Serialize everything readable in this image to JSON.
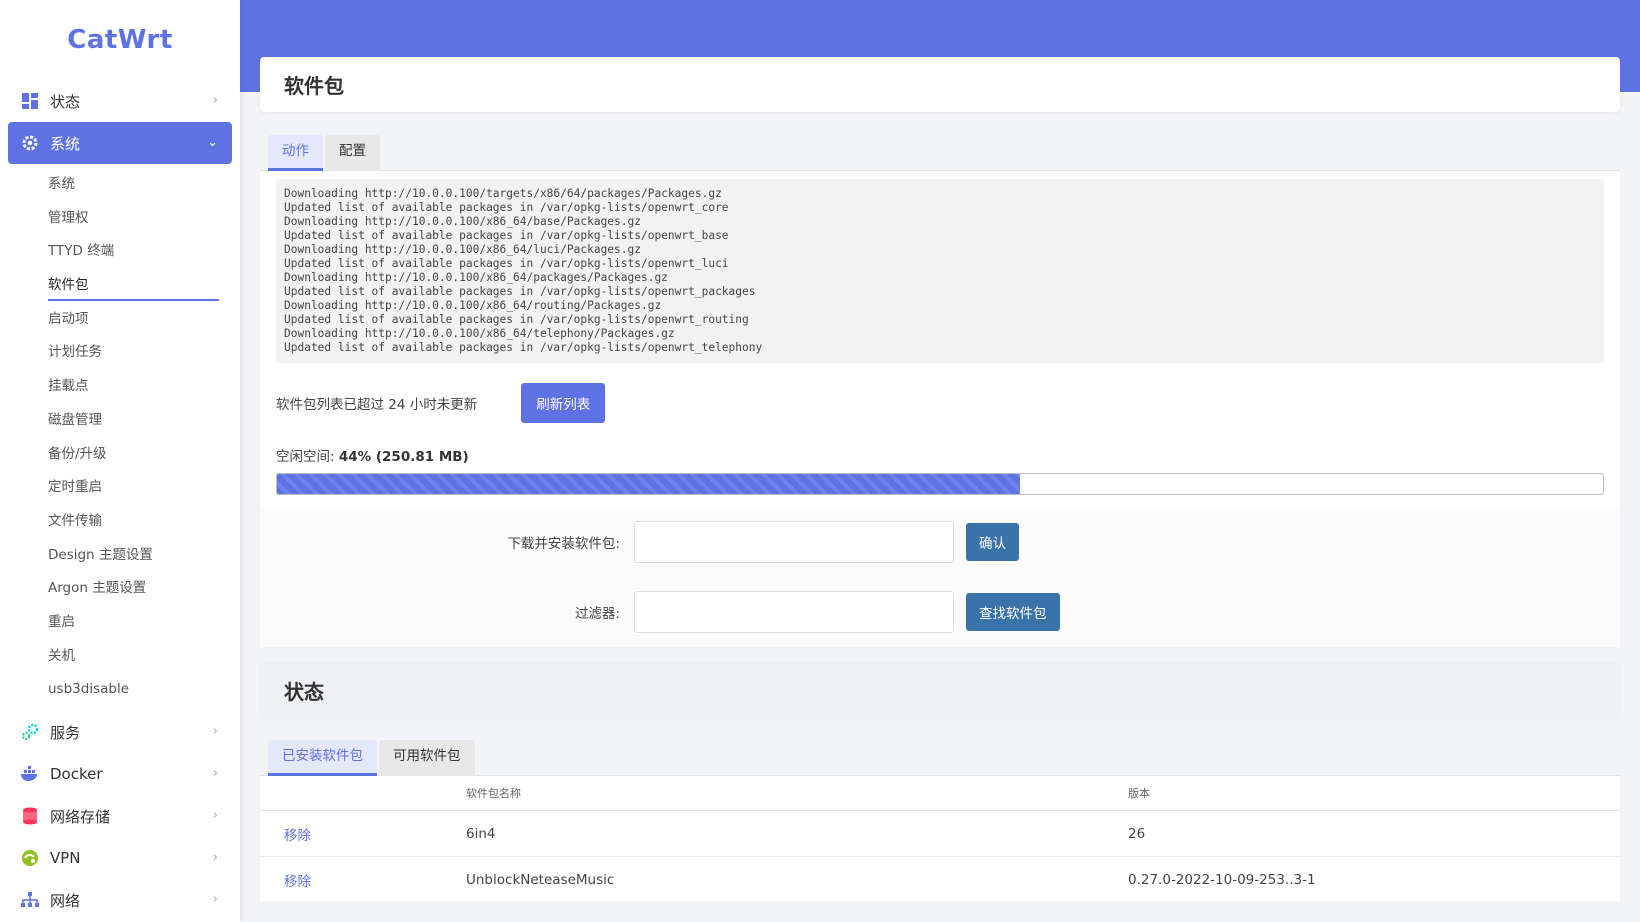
{
  "app": {
    "logo": "CatWrt"
  },
  "sidebar": {
    "groups": [
      {
        "label": "状态",
        "icon": "dashboard-icon"
      },
      {
        "label": "系统",
        "icon": "gear-icon"
      },
      {
        "label": "服务",
        "icon": "services-icon"
      },
      {
        "label": "Docker",
        "icon": "docker-icon"
      },
      {
        "label": "网络存储",
        "icon": "storage-icon"
      },
      {
        "label": "VPN",
        "icon": "vpn-icon"
      },
      {
        "label": "网络",
        "icon": "network-icon"
      }
    ],
    "system_items": [
      "系统",
      "管理权",
      "TTYD 终端",
      "软件包",
      "启动项",
      "计划任务",
      "挂载点",
      "磁盘管理",
      "备份/升级",
      "定时重启",
      "文件传输",
      "Design 主题设置",
      "Argon 主题设置",
      "重启",
      "关机",
      "usb3disable"
    ]
  },
  "page": {
    "title": "软件包",
    "tabs": [
      "动作",
      "配置"
    ],
    "log": "Downloading http://10.0.0.100/targets/x86/64/packages/Packages.gz\nUpdated list of available packages in /var/opkg-lists/openwrt_core\nDownloading http://10.0.0.100/x86_64/base/Packages.gz\nUpdated list of available packages in /var/opkg-lists/openwrt_base\nDownloading http://10.0.0.100/x86_64/luci/Packages.gz\nUpdated list of available packages in /var/opkg-lists/openwrt_luci\nDownloading http://10.0.0.100/x86_64/packages/Packages.gz\nUpdated list of available packages in /var/opkg-lists/openwrt_packages\nDownloading http://10.0.0.100/x86_64/routing/Packages.gz\nUpdated list of available packages in /var/opkg-lists/openwrt_routing\nDownloading http://10.0.0.100/x86_64/telephony/Packages.gz\nUpdated list of available packages in /var/opkg-lists/openwrt_telephony",
    "update_notice": "软件包列表已超过 24 小时未更新",
    "refresh_label": "刷新列表",
    "free_space_label": "空闲空间:",
    "free_space_value": "44% (250.81 MB)",
    "free_space_percent": 56,
    "install_label": "下载并安装软件包:",
    "install_value": "",
    "confirm_label": "确认",
    "filter_label": "过滤器:",
    "filter_value": "",
    "find_label": "查找软件包"
  },
  "status": {
    "title": "状态",
    "tabs": [
      "已安装软件包",
      "可用软件包"
    ],
    "columns": [
      "",
      "软件包名称",
      "版本"
    ],
    "rows": [
      {
        "action": "移除",
        "name": "6in4",
        "version": "26"
      },
      {
        "action": "移除",
        "name": "UnblockNeteaseMusic",
        "version": "0.27.0-2022-10-09-253..3-1"
      }
    ]
  },
  "colors": {
    "accent": "#5e72e4",
    "action_button": "#3a73a9"
  }
}
